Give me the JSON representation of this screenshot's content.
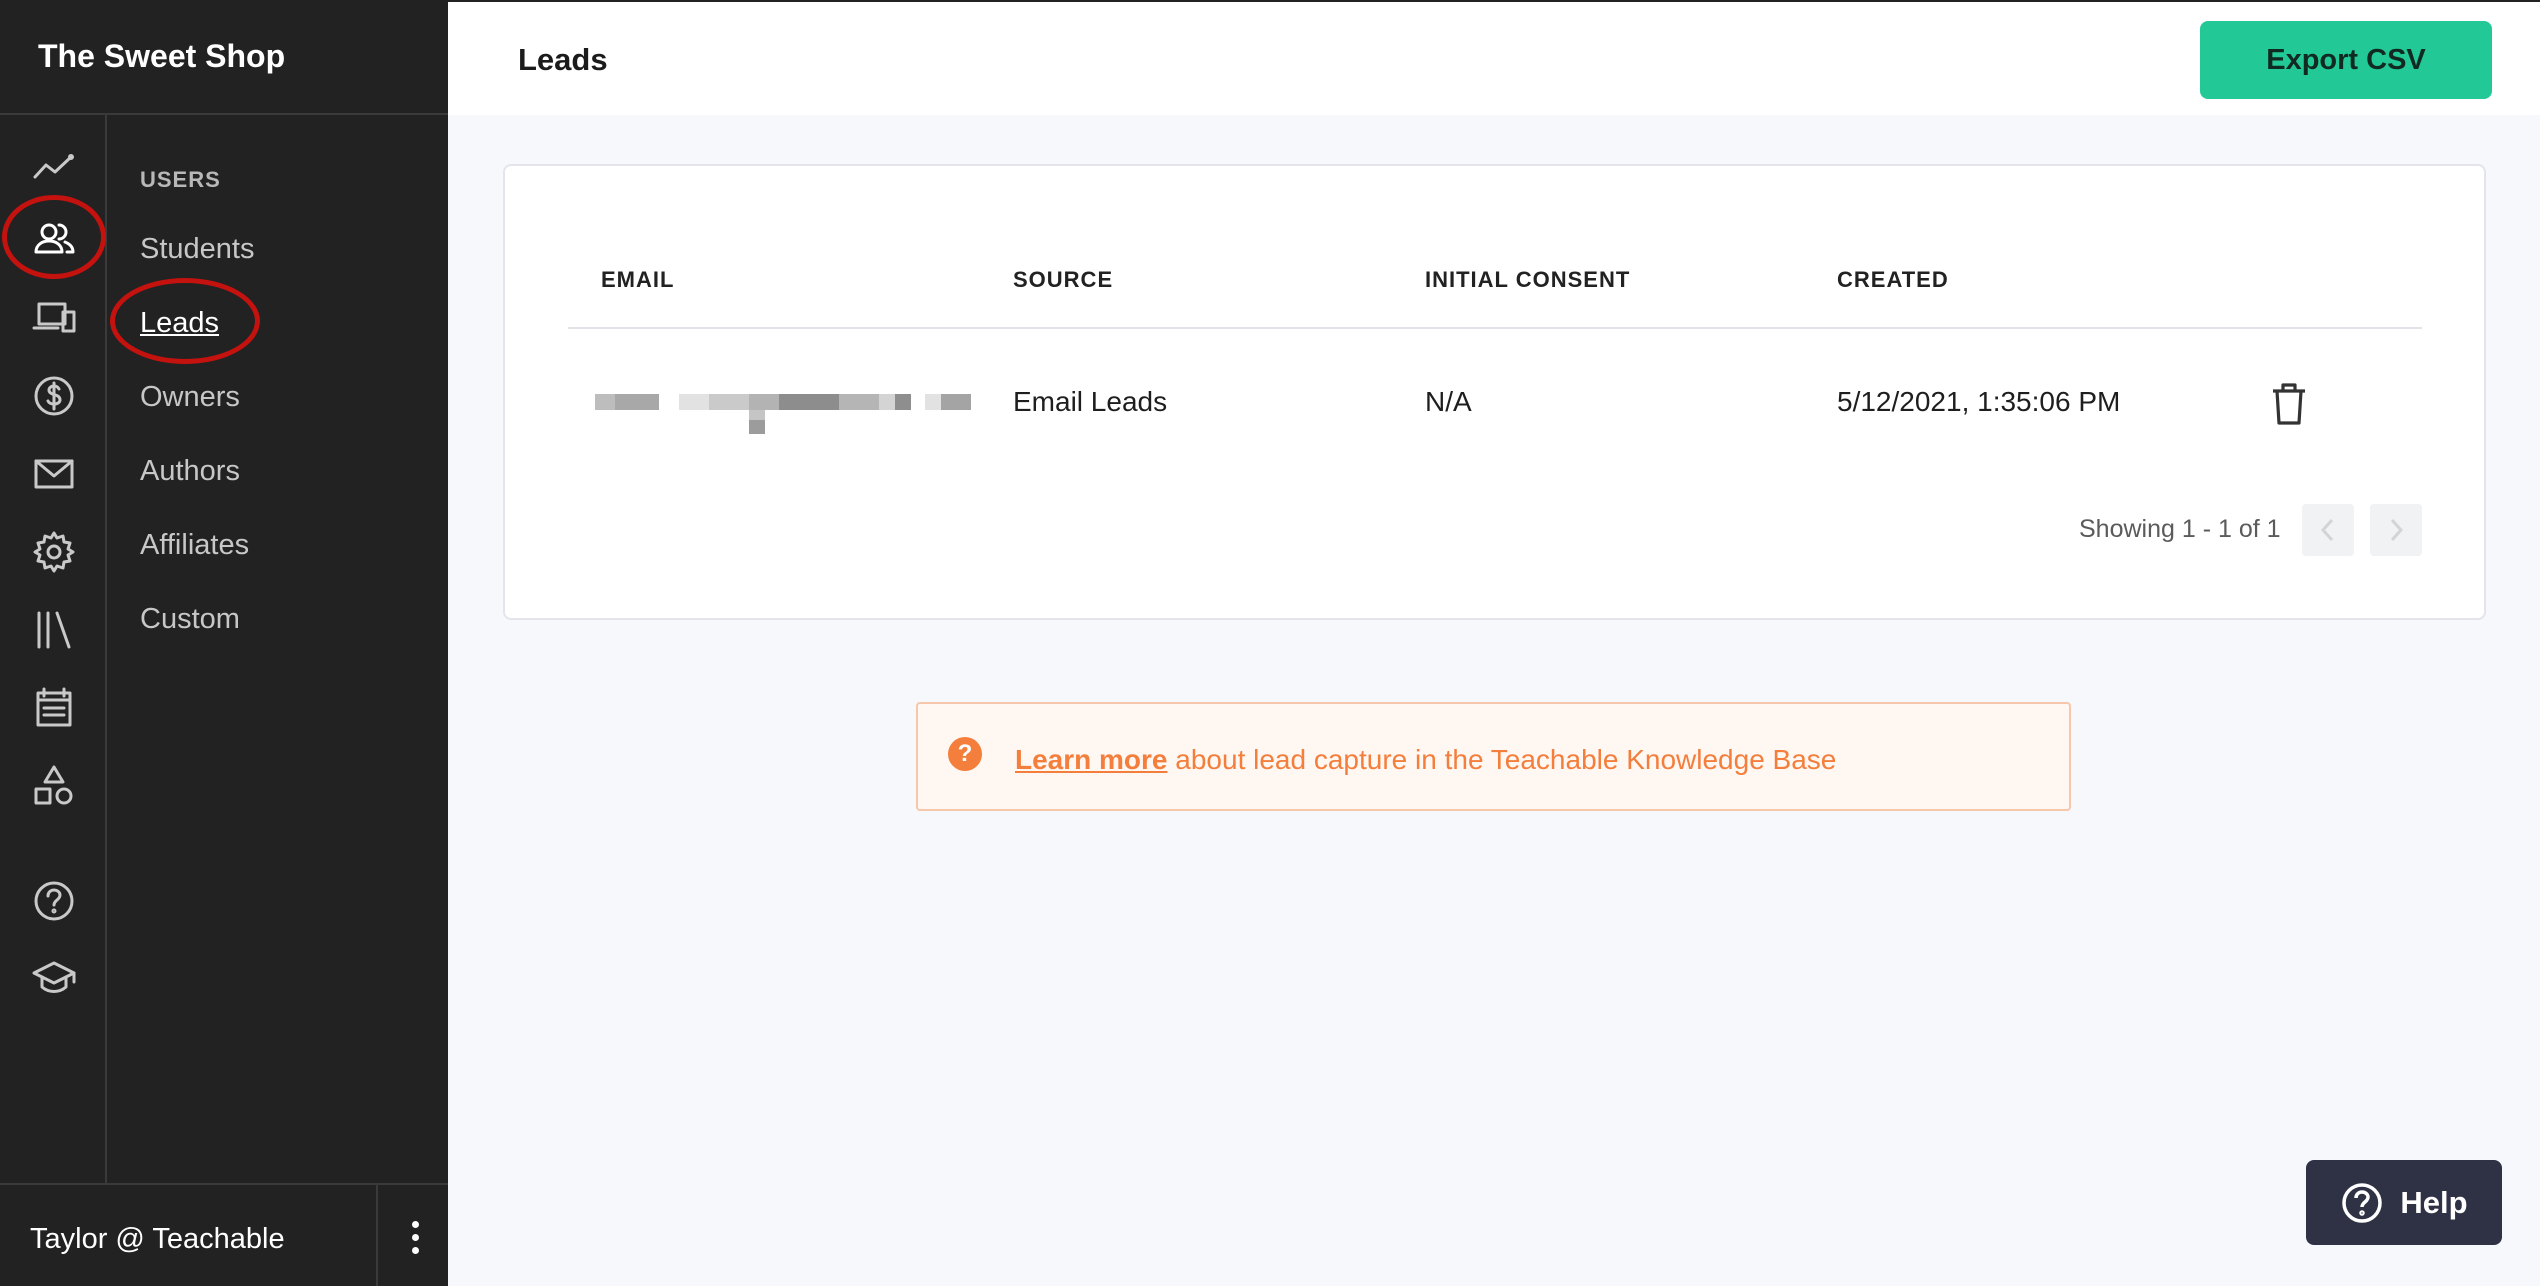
{
  "app": {
    "brand": "The Sweet Shop"
  },
  "header": {
    "title": "Leads",
    "export_label": "Export CSV"
  },
  "sidebar": {
    "rail": [
      "analytics-icon",
      "users-icon",
      "devices-icon",
      "dollar-icon",
      "mail-icon",
      "gear-icon",
      "library-icon",
      "calendar-icon",
      "shapes-icon",
      "question-icon",
      "graduation-cap-icon"
    ],
    "section_title": "USERS",
    "items": [
      {
        "label": "Students",
        "active": false
      },
      {
        "label": "Leads",
        "active": true
      },
      {
        "label": "Owners",
        "active": false
      },
      {
        "label": "Authors",
        "active": false
      },
      {
        "label": "Affiliates",
        "active": false
      },
      {
        "label": "Custom",
        "active": false
      }
    ],
    "user": "Taylor @ Teachable"
  },
  "table": {
    "columns": [
      "EMAIL",
      "SOURCE",
      "INITIAL CONSENT",
      "CREATED"
    ],
    "rows": [
      {
        "email": "",
        "source": "Email Leads",
        "initial_consent": "N/A",
        "created": "5/12/2021, 1:35:06 PM"
      }
    ],
    "pagination": {
      "text": "Showing 1 - 1 of 1"
    }
  },
  "notice": {
    "link": "Learn more",
    "text": " about lead capture in the Teachable Knowledge Base"
  },
  "help": {
    "label": "Help"
  },
  "colors": {
    "sidebar_bg": "#222222",
    "accent_green": "#22c996",
    "notice_orange": "#f47e3c",
    "annotation_red": "#c4120f",
    "help_bg": "#2f3244"
  }
}
